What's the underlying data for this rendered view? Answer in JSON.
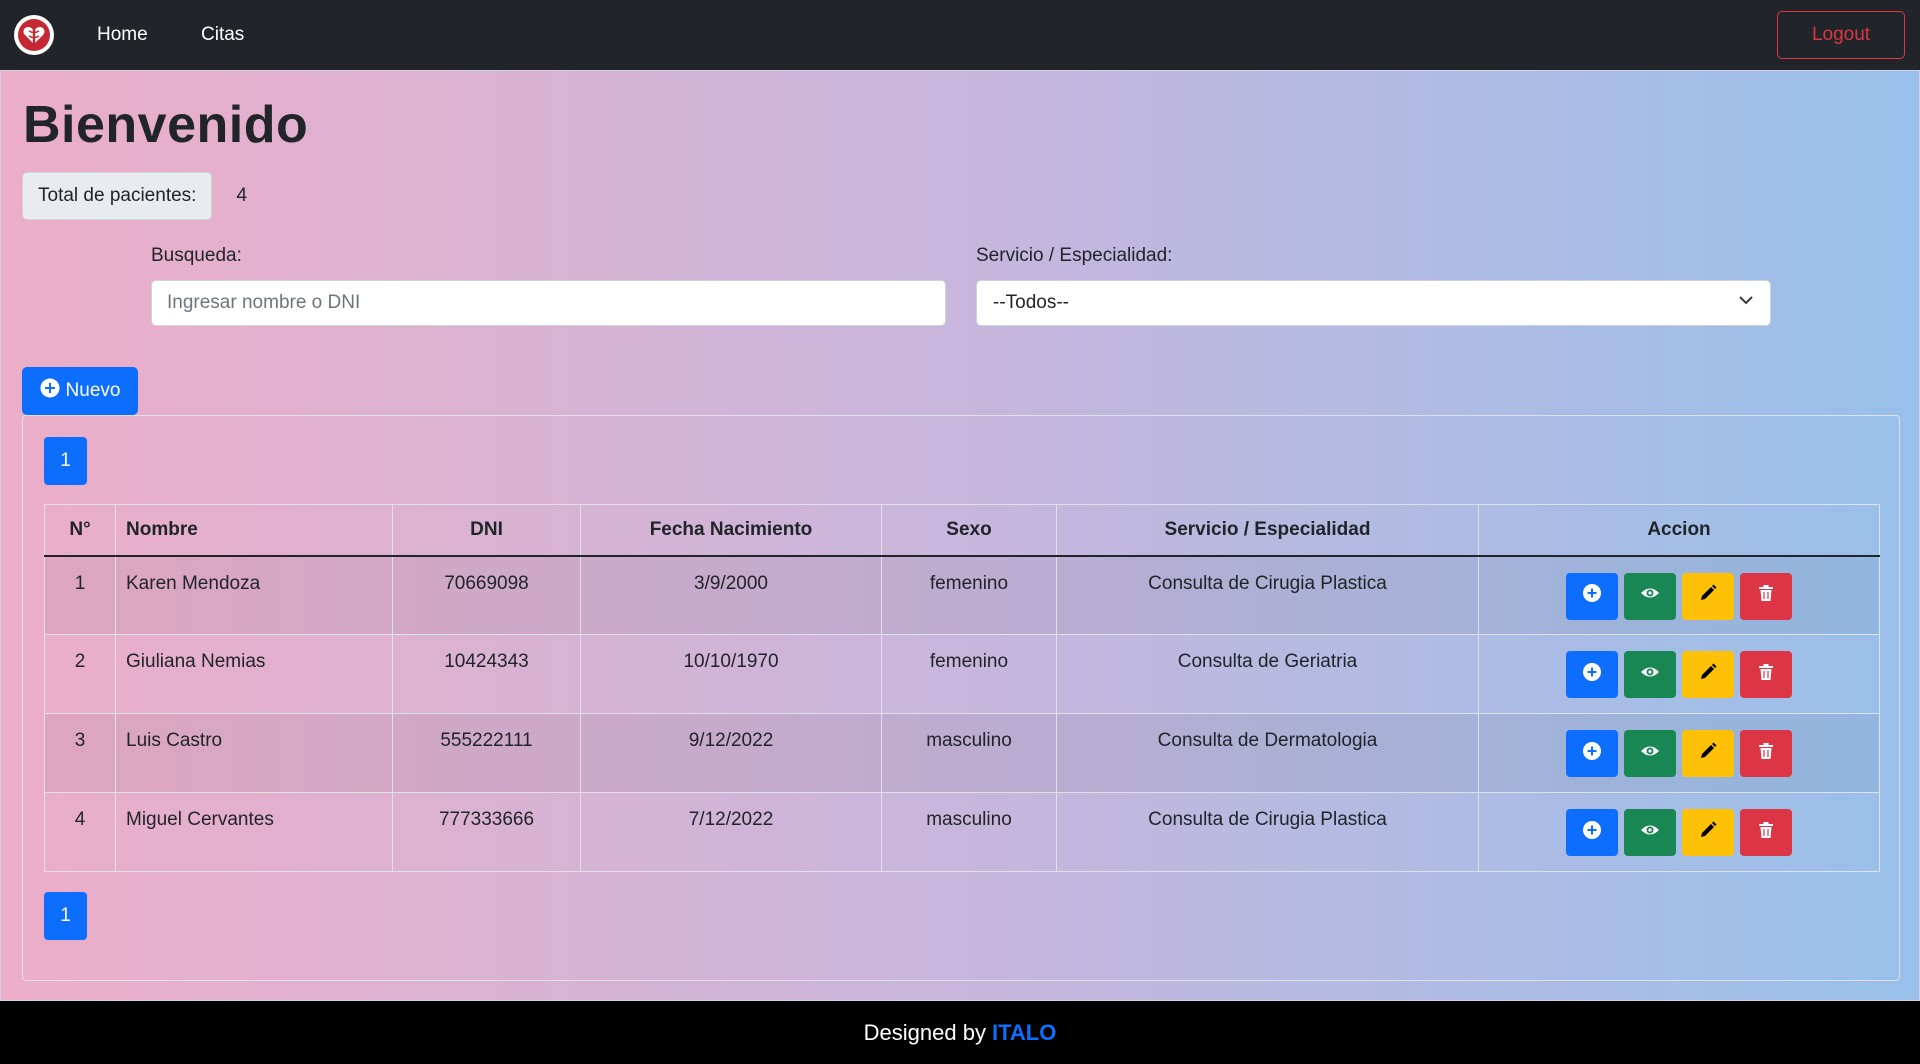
{
  "navbar": {
    "logo_icon": "caduceus-heart-icon",
    "links": [
      "Home",
      "Citas"
    ],
    "logout_label": "Logout"
  },
  "header": {
    "title": "Bienvenido",
    "total_label": "Total de pacientes:",
    "total_value": "4"
  },
  "filters": {
    "search_label": "Busqueda:",
    "search_placeholder": "Ingresar nombre o DNI",
    "service_label": "Servicio / Especialidad:",
    "service_selected": "--Todos--"
  },
  "new_button_label": "Nuevo",
  "pagination": {
    "current_page": "1"
  },
  "table": {
    "columns": [
      "N°",
      "Nombre",
      "DNI",
      "Fecha Nacimiento",
      "Sexo",
      "Servicio / Especialidad",
      "Accion"
    ],
    "rows": [
      {
        "n": "1",
        "nombre": "Karen Mendoza",
        "dni": "70669098",
        "fecha": "3/9/2000",
        "sexo": "femenino",
        "servicio": "Consulta de Cirugia Plastica"
      },
      {
        "n": "2",
        "nombre": "Giuliana Nemias",
        "dni": "10424343",
        "fecha": "10/10/1970",
        "sexo": "femenino",
        "servicio": "Consulta de Geriatria"
      },
      {
        "n": "3",
        "nombre": "Luis Castro",
        "dni": "555222111",
        "fecha": "9/12/2022",
        "sexo": "masculino",
        "servicio": "Consulta de Dermatologia"
      },
      {
        "n": "4",
        "nombre": "Miguel Cervantes",
        "dni": "777333666",
        "fecha": "7/12/2022",
        "sexo": "masculino",
        "servicio": "Consulta de Cirugia Plastica"
      }
    ],
    "action_icons": [
      "plus-circle-icon",
      "eye-icon",
      "pencil-icon",
      "trash-icon"
    ]
  },
  "footer": {
    "text": "Designed by",
    "author": "ITALO"
  },
  "colors": {
    "primary": "#0d6efd",
    "success": "#198754",
    "warning": "#ffc107",
    "danger": "#dc3545",
    "navbar": "#212529"
  }
}
